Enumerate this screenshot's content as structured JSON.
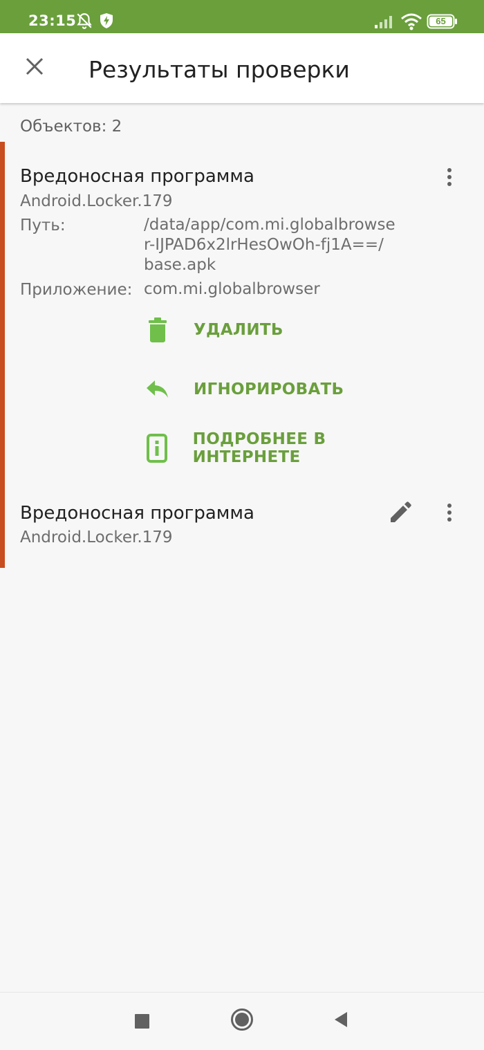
{
  "status_bar": {
    "time": "23:15",
    "battery": "65",
    "icons": [
      "alarm-off-icon",
      "shield-bolt-icon",
      "signal-icon",
      "wifi-icon",
      "battery-icon"
    ]
  },
  "app_bar": {
    "title": "Результаты проверки",
    "close_icon": "close-icon"
  },
  "summary": {
    "count_text": "Объектов: 2"
  },
  "colors": {
    "accent_green": "#6a9f3c",
    "threat_red": "#c84d1f"
  },
  "threats": [
    {
      "title": "Вредоносная программа",
      "name": "Android.Locker.179",
      "path_label": "Путь:",
      "path_lines": [
        "/data/app/com.mi.globalbrowse",
        "r-IJPAD6x2lrHesOwOh-fj1A==/",
        "base.apk"
      ],
      "app_label": "Приложение:",
      "app_value": "com.mi.globalbrowser",
      "actions": [
        {
          "label": "УДАЛИТЬ",
          "icon": "trash-icon"
        },
        {
          "label": "ИГНОРИРОВАТЬ",
          "icon": "reply-icon"
        },
        {
          "label": "ПОДРОБНЕЕ В ИНТЕРНЕТЕ",
          "icon": "info-icon"
        }
      ]
    },
    {
      "title": "Вредоносная программа",
      "name": "Android.Locker.179"
    }
  ],
  "nav_bar": {
    "buttons": [
      "recents-square-icon",
      "home-circle-icon",
      "back-triangle-icon"
    ]
  }
}
